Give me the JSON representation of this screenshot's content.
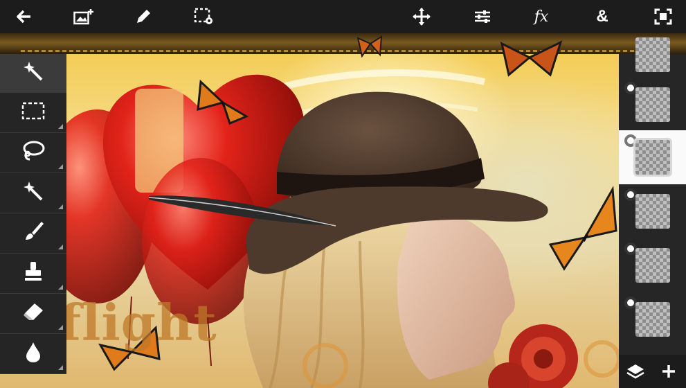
{
  "toolbar": {
    "icons": [
      {
        "name": "back-arrow-icon"
      },
      {
        "name": "add-image-icon"
      },
      {
        "name": "pencil-icon"
      },
      {
        "name": "selection-settings-icon"
      },
      {
        "name": "move-icon"
      },
      {
        "name": "adjustments-icon"
      },
      {
        "name": "effects-icon",
        "label": "fx"
      },
      {
        "name": "blend-icon",
        "label": "&"
      },
      {
        "name": "fit-screen-icon"
      }
    ]
  },
  "tools": [
    {
      "name": "auto-select-wand-icon",
      "active": true
    },
    {
      "name": "rect-select-icon"
    },
    {
      "name": "lasso-icon"
    },
    {
      "name": "magic-wand-icon"
    },
    {
      "name": "brush-icon"
    },
    {
      "name": "clone-stamp-icon"
    },
    {
      "name": "eraser-icon"
    },
    {
      "name": "blur-drop-icon"
    }
  ],
  "layers": [
    {
      "name": "layer-0"
    },
    {
      "name": "layer-1"
    },
    {
      "name": "layer-2",
      "selected": true
    },
    {
      "name": "layer-3"
    },
    {
      "name": "layer-4"
    },
    {
      "name": "layer-5"
    }
  ],
  "layer_footer": {
    "icons": [
      {
        "name": "layers-icon"
      },
      {
        "name": "add-layer-icon"
      }
    ]
  },
  "artwork": {
    "text": "flight"
  },
  "colors": {
    "toolbar_bg": "#1c1c1c",
    "panel_bg": "#252525",
    "active_tool_bg": "#3b3b3b",
    "selected_layer_bg": "#fafafa"
  }
}
